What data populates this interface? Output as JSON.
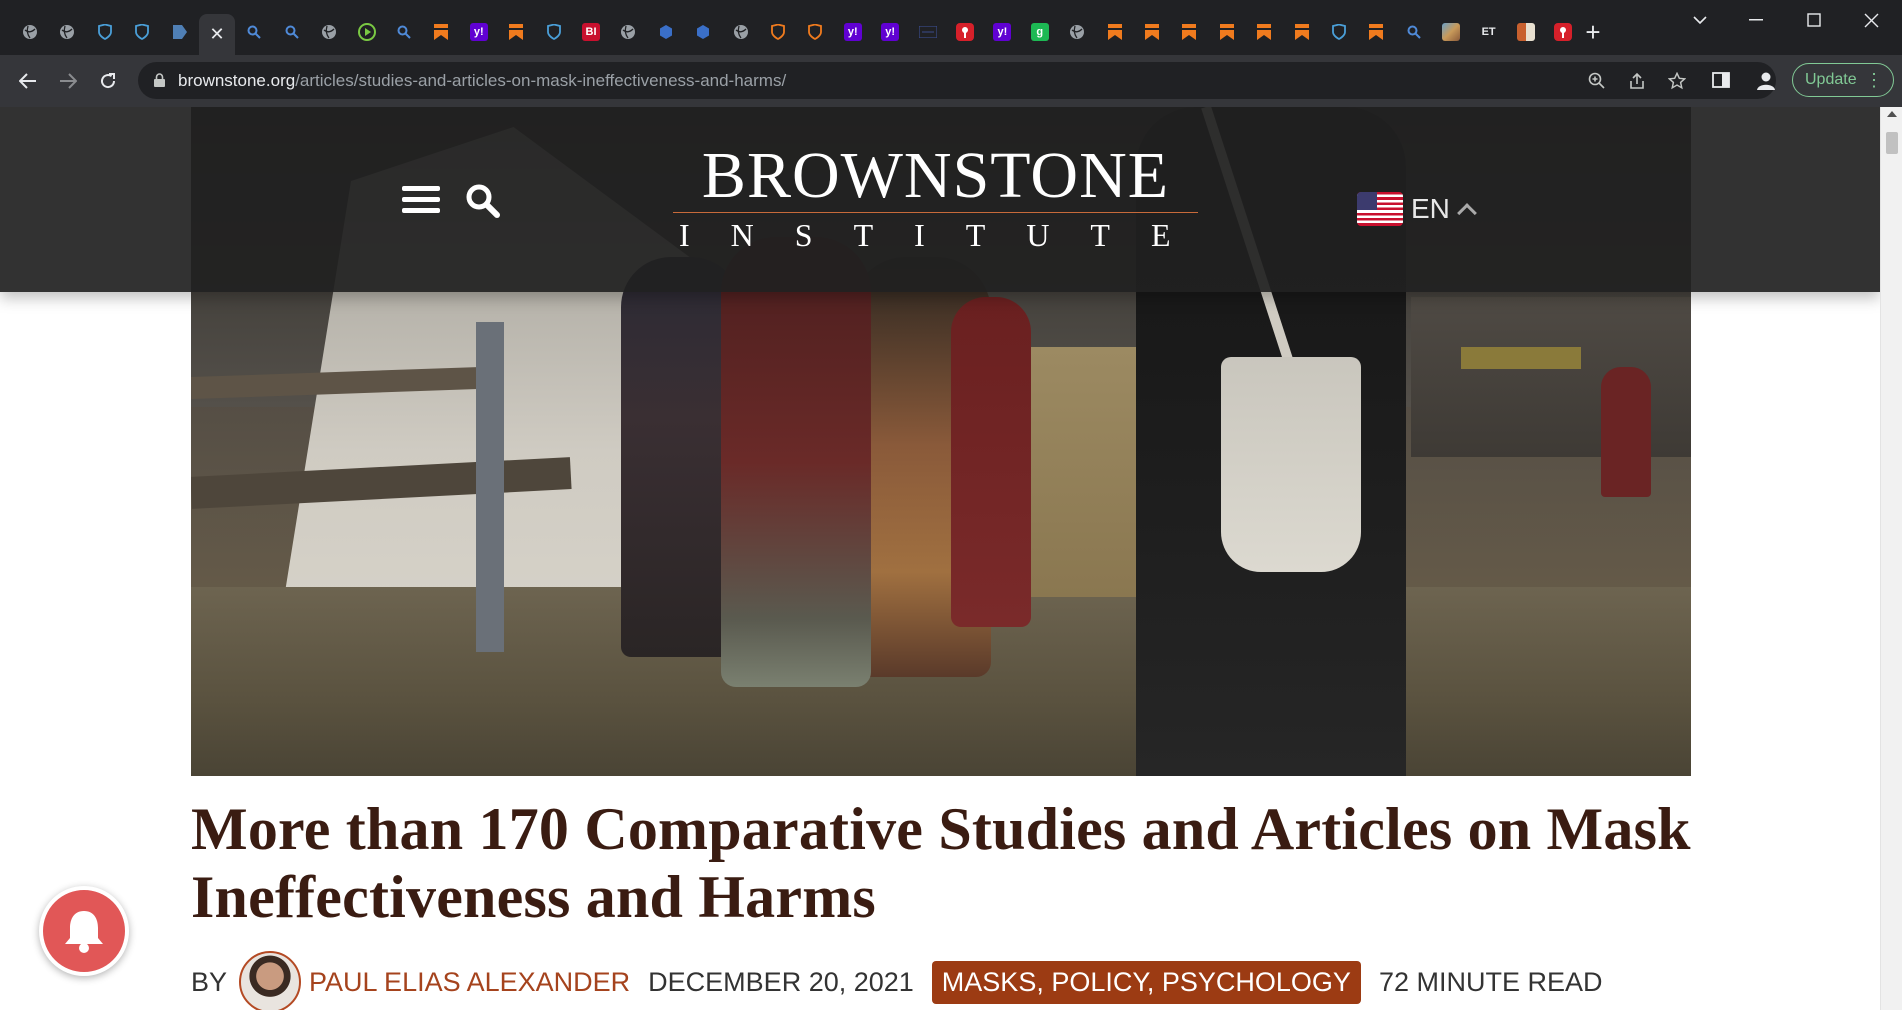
{
  "browser": {
    "tabs": [
      {
        "icon": "globe-icon",
        "color": "#9aa0a6"
      },
      {
        "icon": "globe-icon",
        "color": "#9aa0a6"
      },
      {
        "icon": "shield-heart-icon",
        "color": "#4a9fd8"
      },
      {
        "icon": "shield-heart-icon",
        "color": "#4a9fd8"
      },
      {
        "icon": "bookmark-tab-icon",
        "color": "#4f7fb5"
      },
      {
        "icon": "close-icon",
        "active": true
      },
      {
        "icon": "search-icon",
        "color": "#4f8ad8"
      },
      {
        "icon": "search-icon",
        "color": "#4f8ad8"
      },
      {
        "icon": "globe-icon",
        "color": "#9aa0a6"
      },
      {
        "icon": "play-icon",
        "color": "#7ac943"
      },
      {
        "icon": "search-icon",
        "color": "#4f8ad8"
      },
      {
        "icon": "ribbon-icon",
        "color": "#f07b1e"
      },
      {
        "icon": "yahoo-icon",
        "color": "#6001d2",
        "text": "y!"
      },
      {
        "icon": "ribbon-icon",
        "color": "#f07b1e"
      },
      {
        "icon": "shield-heart-icon",
        "color": "#4a9fd8"
      },
      {
        "icon": "bi-icon",
        "color": "#c8102e",
        "text": "BI"
      },
      {
        "icon": "globe-icon",
        "color": "#9aa0a6"
      },
      {
        "icon": "hex-icon",
        "color": "#3a6fc8"
      },
      {
        "icon": "hex-icon",
        "color": "#3a6fc8"
      },
      {
        "icon": "globe-icon",
        "color": "#9aa0a6"
      },
      {
        "icon": "badge-icon",
        "color": "#f07b1e"
      },
      {
        "icon": "badge-icon",
        "color": "#f07b1e"
      },
      {
        "icon": "yahoo-icon",
        "color": "#6001d2",
        "text": "y!"
      },
      {
        "icon": "yahoo-icon",
        "color": "#6001d2",
        "text": "y!"
      },
      {
        "icon": "grid-icon",
        "color": "#3a4a8a"
      },
      {
        "icon": "red-pin-icon",
        "color": "#d6202a"
      },
      {
        "icon": "yahoo-icon",
        "color": "#6001d2",
        "text": "y!"
      },
      {
        "icon": "g-icon",
        "color": "#1db954",
        "text": "g"
      },
      {
        "icon": "globe-icon",
        "color": "#9aa0a6"
      },
      {
        "icon": "ribbon-icon",
        "color": "#f07b1e"
      },
      {
        "icon": "ribbon-icon",
        "color": "#f07b1e"
      },
      {
        "icon": "ribbon-icon",
        "color": "#f07b1e"
      },
      {
        "icon": "ribbon-icon",
        "color": "#f07b1e"
      },
      {
        "icon": "ribbon-icon",
        "color": "#f07b1e"
      },
      {
        "icon": "ribbon-icon",
        "color": "#f07b1e"
      },
      {
        "icon": "shield-heart-icon",
        "color": "#4a9fd8"
      },
      {
        "icon": "ribbon-icon",
        "color": "#f07b1e"
      },
      {
        "icon": "search-icon",
        "color": "#4f8ad8"
      },
      {
        "icon": "photo-icon",
        "color": "#c89a5a"
      },
      {
        "icon": "et-icon",
        "color": "#e8eaed",
        "text": "ET"
      },
      {
        "icon": "crest-icon",
        "color": "#c8602e"
      },
      {
        "icon": "red-pin-icon",
        "color": "#d6202a"
      }
    ],
    "new_tab_label": "+",
    "url_host": "brownstone.org",
    "url_path": "/articles/studies-and-articles-on-mask-ineffectiveness-and-harms/",
    "update_label": "Update"
  },
  "site": {
    "logo_line1": "BROWNSTONE",
    "logo_line2": "INSTITUTE",
    "language": "EN"
  },
  "article": {
    "title": "More than 170 Comparative Studies and Articles on Mask Ineffectiveness and Harms",
    "by": "BY",
    "author": "PAUL ELIAS ALEXANDER",
    "date": "DECEMBER 20, 2021",
    "tags": "MASKS, POLICY, PSYCHOLOGY",
    "read_time": "72 MINUTE READ"
  },
  "colors": {
    "title": "#3a1c12",
    "accent": "#9c3b13",
    "author": "#a5431d",
    "bell": "#e15757"
  }
}
